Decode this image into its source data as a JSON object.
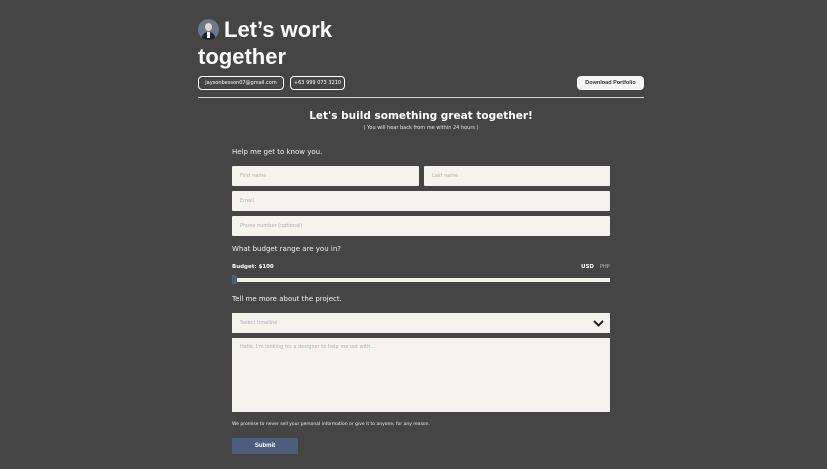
{
  "header": {
    "title": "Let’s work together",
    "email": "jaysonbesson07@gmail.com",
    "phone": "+63 999 073 3210",
    "download_label": "Download Portfolio"
  },
  "form": {
    "title": "Let's build something great together!",
    "subtitle": "( You will hear back from me within 24 hours )",
    "section_about": "Help me get to know you.",
    "first_name_placeholder": "First name",
    "last_name_placeholder": "Last name",
    "email_placeholder": "Email",
    "phone_placeholder": "Phone number (optional)",
    "section_budget": "What budget range are you in?",
    "budget_label": "Budget: $100",
    "currency_usd": "USD",
    "currency_php": "PHP",
    "budget_value": 100,
    "section_project": "Tell me more about the project.",
    "timeline_placeholder": "Select timeline",
    "message_placeholder": "Hello, I'm looking for a designer to help me out with...",
    "privacy_note": "We promise to never sell your personal information or give it to anyone, for any reason.",
    "submit_label": "Submit"
  },
  "colors": {
    "background": "#454545",
    "field": "#f5f3ee",
    "accent": "#4d5d7e"
  }
}
